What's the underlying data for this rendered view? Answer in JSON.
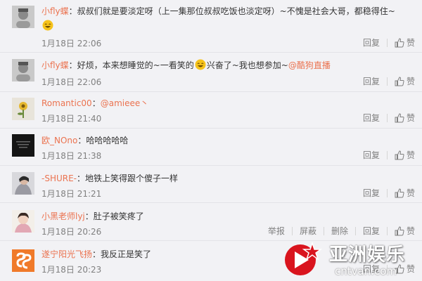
{
  "comments": [
    {
      "author": "小fly蝶",
      "text_before_emoji": "：叔叔们就是要淡定呀（上一集那位叔叔吃饭也淡定呀）~不愧是社会大哥，都稳得住~",
      "emoji": "laugh-emoji",
      "time": "1月18日 22:06",
      "actions": [
        "回复"
      ],
      "like_label": "赞"
    },
    {
      "author": "小fly蝶",
      "text_before_emoji": "：好烦，本来想睡觉的~一看笑的",
      "emoji": "laugh-emoji",
      "text_after_emoji": "兴奋了~我也想参加~",
      "mention": "@酷狗直播",
      "time": "1月18日 22:06",
      "actions": [
        "回复"
      ],
      "like_label": "赞"
    },
    {
      "author": "Romantic00",
      "text_before_emoji": "：",
      "mention": "@amieee丶",
      "time": "1月18日 21:40",
      "actions": [
        "回复"
      ],
      "like_label": "赞"
    },
    {
      "author": "欧_NOno",
      "text_before_emoji": "：哈哈哈哈哈",
      "time": "1月18日 21:38",
      "actions": [
        "回复"
      ],
      "like_label": "赞"
    },
    {
      "author": "-SHURE-",
      "text_before_emoji": "：地铁上笑得跟个傻子一样",
      "time": "1月18日 21:21",
      "actions": [
        "回复"
      ],
      "like_label": "赞"
    },
    {
      "author": "小黑老师lyj",
      "text_before_emoji": "：肚子被笑疼了",
      "time": "1月18日 20:26",
      "actions": [
        "举报",
        "屏蔽",
        "删除",
        "回复"
      ],
      "like_label": "赞"
    },
    {
      "author": "遂宁阳光飞扬",
      "text_before_emoji": "：我反正是笑了",
      "time": "1月18日 20:23",
      "actions": [
        "回复"
      ],
      "like_label": "赞"
    }
  ],
  "watermark": {
    "title": "亚洲娱乐",
    "url": "cntvan.com"
  },
  "colors": {
    "author": "#eb7350",
    "text": "#333333",
    "meta": "#808080",
    "background": "#f2f2f5",
    "divider": "#e3e3e8"
  }
}
